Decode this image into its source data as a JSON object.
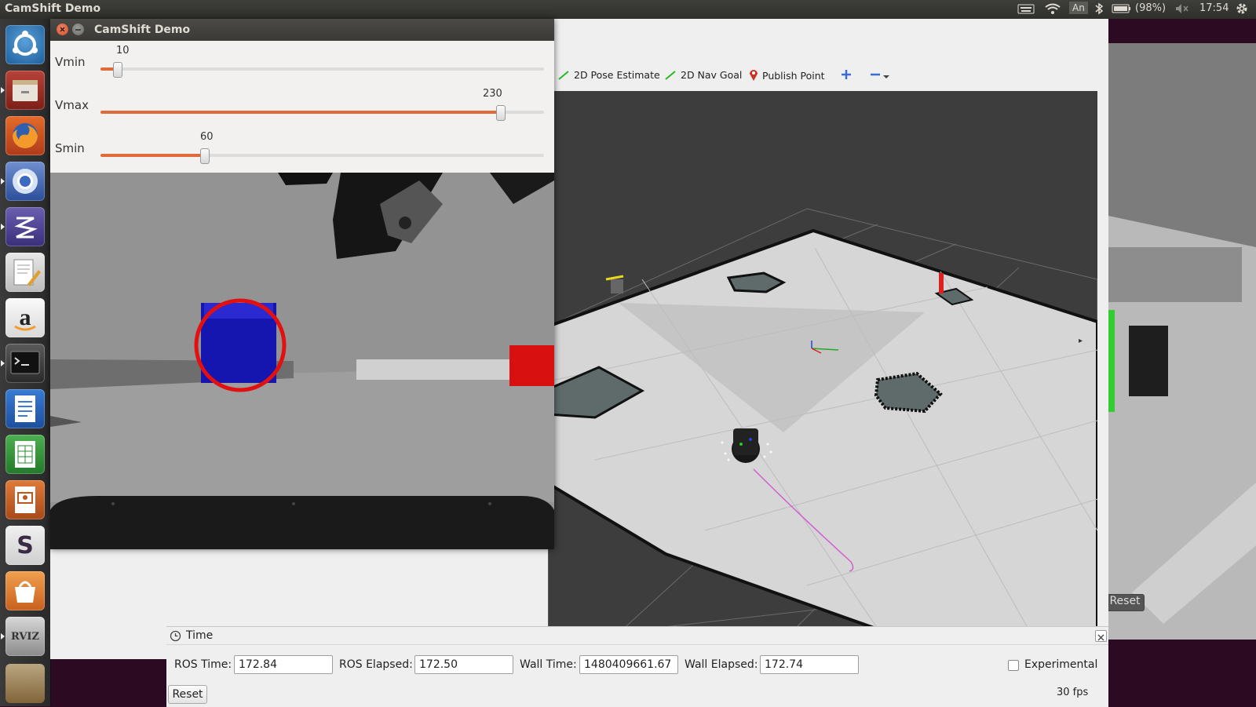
{
  "topbar": {
    "app_title": "CamShift Demo",
    "keyboard_layout": "An",
    "battery": "(98%)",
    "clock": "17:54"
  },
  "launcher": {
    "items": [
      {
        "icon": "ubuntu-dash-icon"
      },
      {
        "icon": "file-manager-icon"
      },
      {
        "icon": "firefox-icon"
      },
      {
        "icon": "chromium-icon"
      },
      {
        "icon": "emacs-icon"
      },
      {
        "icon": "text-editor-icon"
      },
      {
        "icon": "amazon-icon",
        "glyph": "a"
      },
      {
        "icon": "terminal-icon"
      },
      {
        "icon": "libreoffice-writer-icon"
      },
      {
        "icon": "libreoffice-calc-icon"
      },
      {
        "icon": "libreoffice-impress-icon"
      },
      {
        "icon": "slack-icon",
        "glyph": "S"
      },
      {
        "icon": "software-center-icon"
      },
      {
        "icon": "rviz-icon",
        "glyph": "RVIZ"
      }
    ]
  },
  "camshift": {
    "title": "CamShift Demo",
    "sliders": [
      {
        "label": "Vmin",
        "value": "10",
        "min": 0,
        "max": 255,
        "level": 10
      },
      {
        "label": "Vmax",
        "value": "230",
        "min": 0,
        "max": 255,
        "level": 230
      },
      {
        "label": "Smin",
        "value": "60",
        "min": 0,
        "max": 255,
        "level": 60
      }
    ]
  },
  "rviz": {
    "toolbar": {
      "pose_estimate": "2D Pose Estimate",
      "nav_goal": "2D Nav Goal",
      "publish_point": "Publish Point"
    }
  },
  "gazebo": {
    "reset": "Reset"
  },
  "time_panel": {
    "title": "Time",
    "ros_time_label": "ROS Time:",
    "ros_time": "172.84",
    "ros_elapsed_label": "ROS Elapsed:",
    "ros_elapsed": "172.50",
    "wall_time_label": "Wall Time:",
    "wall_time": "1480409661.67",
    "wall_elapsed_label": "Wall Elapsed:",
    "wall_elapsed": "172.74",
    "experimental_label": "Experimental",
    "experimental_checked": false,
    "reset": "Reset",
    "fps": "30 fps"
  }
}
